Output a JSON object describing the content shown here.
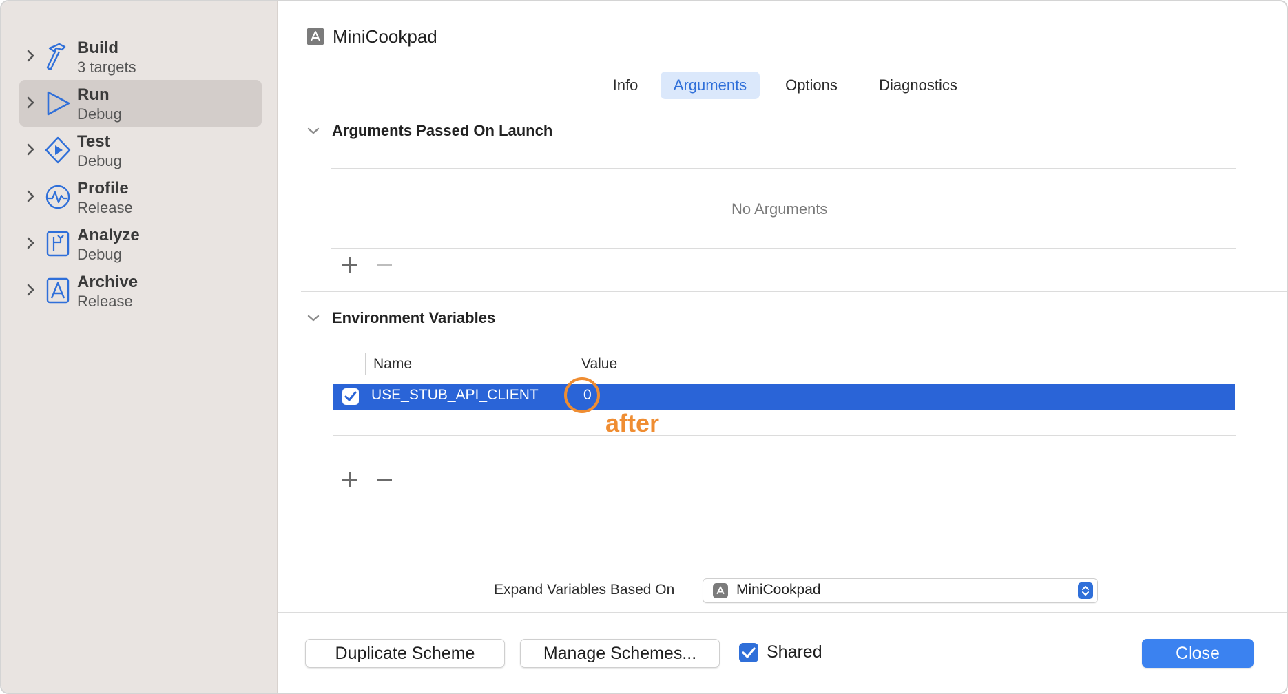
{
  "sidebar": {
    "items": [
      {
        "title": "Build",
        "subtitle": "3 targets",
        "icon": "hammer-icon"
      },
      {
        "title": "Run",
        "subtitle": "Debug",
        "icon": "play-icon"
      },
      {
        "title": "Test",
        "subtitle": "Debug",
        "icon": "test-diamond-icon"
      },
      {
        "title": "Profile",
        "subtitle": "Release",
        "icon": "waveform-icon"
      },
      {
        "title": "Analyze",
        "subtitle": "Debug",
        "icon": "analyze-icon"
      },
      {
        "title": "Archive",
        "subtitle": "Release",
        "icon": "archive-icon"
      }
    ],
    "selected": "Run"
  },
  "header": {
    "title": "MiniCookpad",
    "icon": "app-target-icon"
  },
  "tabs": [
    {
      "label": "Info"
    },
    {
      "label": "Arguments"
    },
    {
      "label": "Options"
    },
    {
      "label": "Diagnostics"
    }
  ],
  "active_tab": "Arguments",
  "arguments_section": {
    "title": "Arguments Passed On Launch",
    "empty_text": "No Arguments"
  },
  "env_section": {
    "title": "Environment Variables",
    "columns": {
      "name": "Name",
      "value": "Value"
    },
    "rows": [
      {
        "enabled": true,
        "name": "USE_STUB_API_CLIENT",
        "value": "0"
      }
    ],
    "annotation": "after"
  },
  "expand_vars": {
    "label": "Expand Variables Based On",
    "value": "MiniCookpad"
  },
  "footer": {
    "duplicate_label": "Duplicate Scheme",
    "manage_label": "Manage Schemes...",
    "shared_label": "Shared",
    "shared_checked": true,
    "close_label": "Close"
  },
  "colors": {
    "accent": "#2f6fd9",
    "selection": "#2a64d7",
    "annotation": "#ef8d32",
    "sidebar_bg": "#e9e4e1"
  }
}
